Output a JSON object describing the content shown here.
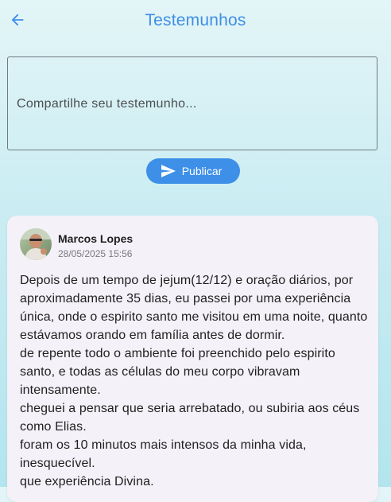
{
  "header": {
    "title": "Testemunhos",
    "back_icon": "arrow-left-icon"
  },
  "composer": {
    "placeholder": "Compartilhe seu testemunho...",
    "value": ""
  },
  "publish_button": {
    "label": "Publicar",
    "icon": "send-icon",
    "color": "#3d8fe8"
  },
  "posts": [
    {
      "author": "Marcos Lopes",
      "date": "28/05/2025 15:56",
      "paragraphs": [
        "Depois de um tempo de jejum(12/12) e oração diários, por aproximadamente 35 dias, eu passei por uma experiência única, onde o espirito santo me visitou em uma noite, quanto estávamos orando em família antes de dormir.",
        "de repente todo o ambiente foi preenchido pelo espirito santo, e todas as células do meu corpo vibravam intensamente.",
        "cheguei a pensar que seria arrebatado, ou subiria aos céus como Elias.",
        "foram os 10 minutos mais intensos da minha vida, inesquecível.",
        "que experiência Divina."
      ]
    }
  ],
  "colors": {
    "accent": "#3f8ee6",
    "card_background": "#f4f1f8"
  }
}
